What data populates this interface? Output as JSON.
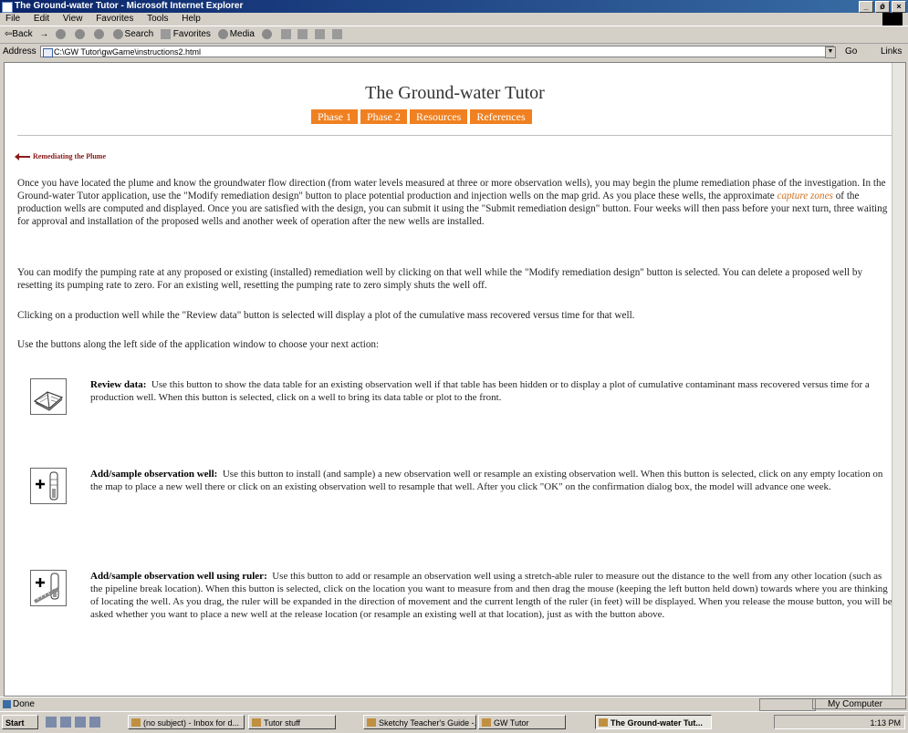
{
  "window": {
    "title": "The Ground-water Tutor - Microsoft Internet Explorer",
    "controls": [
      "_",
      "ǿ",
      "×"
    ]
  },
  "menu": [
    "File",
    "Edit",
    "View",
    "Favorites",
    "Tools",
    "Help"
  ],
  "toolbar": {
    "back": "⇦Back",
    "forward": "→",
    "search": "Search",
    "favorites": "Favorites",
    "media": "Media"
  },
  "address": {
    "label": "Address",
    "value": "C:\\GW Tutor\\gwGame\\instructions2.html",
    "go": "Go",
    "links": "Links"
  },
  "page": {
    "title": "The Ground-water Tutor",
    "tabs": [
      "Phase 1",
      "Phase 2",
      "Resources",
      "References"
    ],
    "back_link": "Remediating the Plume",
    "p1_before": "Once you have located the plume and know the groundwater flow direction (from water levels measured at three or more observation wells), you may begin the plume remediation phase of the investigation. In the Ground-water Tutor application, use the \"Modify remediation design\" button to place potential production and injection wells on the map grid. As you place these wells, the approximate ",
    "p1_link": "capture zones",
    "p1_after": " of the production wells are computed and displayed. Once you are satisfied with the design, you can submit it using the \"Submit remediation design\" button. Four weeks will then pass before your next turn, three waiting for approval and installation of the proposed wells and another week of operation after the new wells are installed.",
    "p2": "You can modify the pumping rate at any proposed or existing (installed) remediation well by clicking on that well while the \"Modify remediation design\" button is selected. You can delete a proposed well by resetting its pumping rate to zero. For an existing well, resetting the pumping rate to zero simply shuts the well off.",
    "p3": "Clicking on a production well while the \"Review data\" button is selected will display a plot of the cumulative mass recovered versus time for that well.",
    "p4": "Use the buttons along the left side of the application window to choose your next action:",
    "items": [
      {
        "title": "Review data:",
        "text": "Use this button to show the data table for an existing observation well if that table has been hidden or to display a plot of cumulative contaminant mass recovered versus time for a production well. When this button is selected, click on a well to bring its data table or plot to the front."
      },
      {
        "title": "Add/sample observation well:",
        "text": "Use this button to install (and sample) a new observation well or resample an existing observation well. When this button is selected, click on any empty location on the map to place a new well there or click on an existing observation well to resample that well. After you click \"OK\" on the confirmation dialog box, the model will advance one week."
      },
      {
        "title": "Add/sample observation well using ruler:",
        "text": "Use this button to add or resample an observation well using a stretch-able ruler to measure out the distance to the well from any other location (such as the pipeline break location). When this button is selected, click on the location you want to measure from and then drag the mouse (keeping the left button held down) towards where you are thinking of locating the well. As you drag, the ruler will be expanded in the direction of movement and the current length of the ruler (in feet) will be displayed. When you release the mouse button, you will be asked whether you want to place a new well at the release location (or resample an existing well at that location), just as with the button above."
      }
    ]
  },
  "status": {
    "left": "Done",
    "right": "My Computer"
  },
  "taskbar": {
    "start": "Start",
    "tasks": [
      "(no subject) - Inbox for d...",
      "Tutor stuff",
      "Sketchy Teacher's Guide -...",
      "GW Tutor",
      "The Ground-water Tut..."
    ],
    "clock": "1:13 PM"
  },
  "colors": {
    "accent": "#f08020",
    "link": "#d07020",
    "back_link": "#8b1a1a",
    "titlebar": "#0a246a"
  }
}
